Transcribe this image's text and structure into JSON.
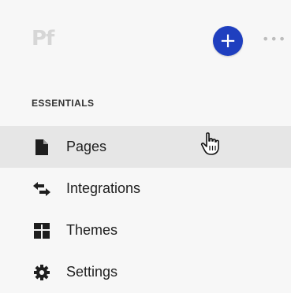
{
  "header": {
    "logo_text": "Pf",
    "add_label": "+",
    "more_label": "•••"
  },
  "section": {
    "label": "ESSENTIALS"
  },
  "nav": {
    "items": [
      {
        "label": "Pages",
        "icon": "page-icon",
        "active": true
      },
      {
        "label": "Integrations",
        "icon": "swap-arrows-icon",
        "active": false
      },
      {
        "label": "Themes",
        "icon": "layout-grid-icon",
        "active": false
      },
      {
        "label": "Settings",
        "icon": "gear-icon",
        "active": false
      }
    ]
  },
  "colors": {
    "accent": "#1f3fbf",
    "active_row": "#e6e6e6",
    "background": "#f7f7f7"
  }
}
